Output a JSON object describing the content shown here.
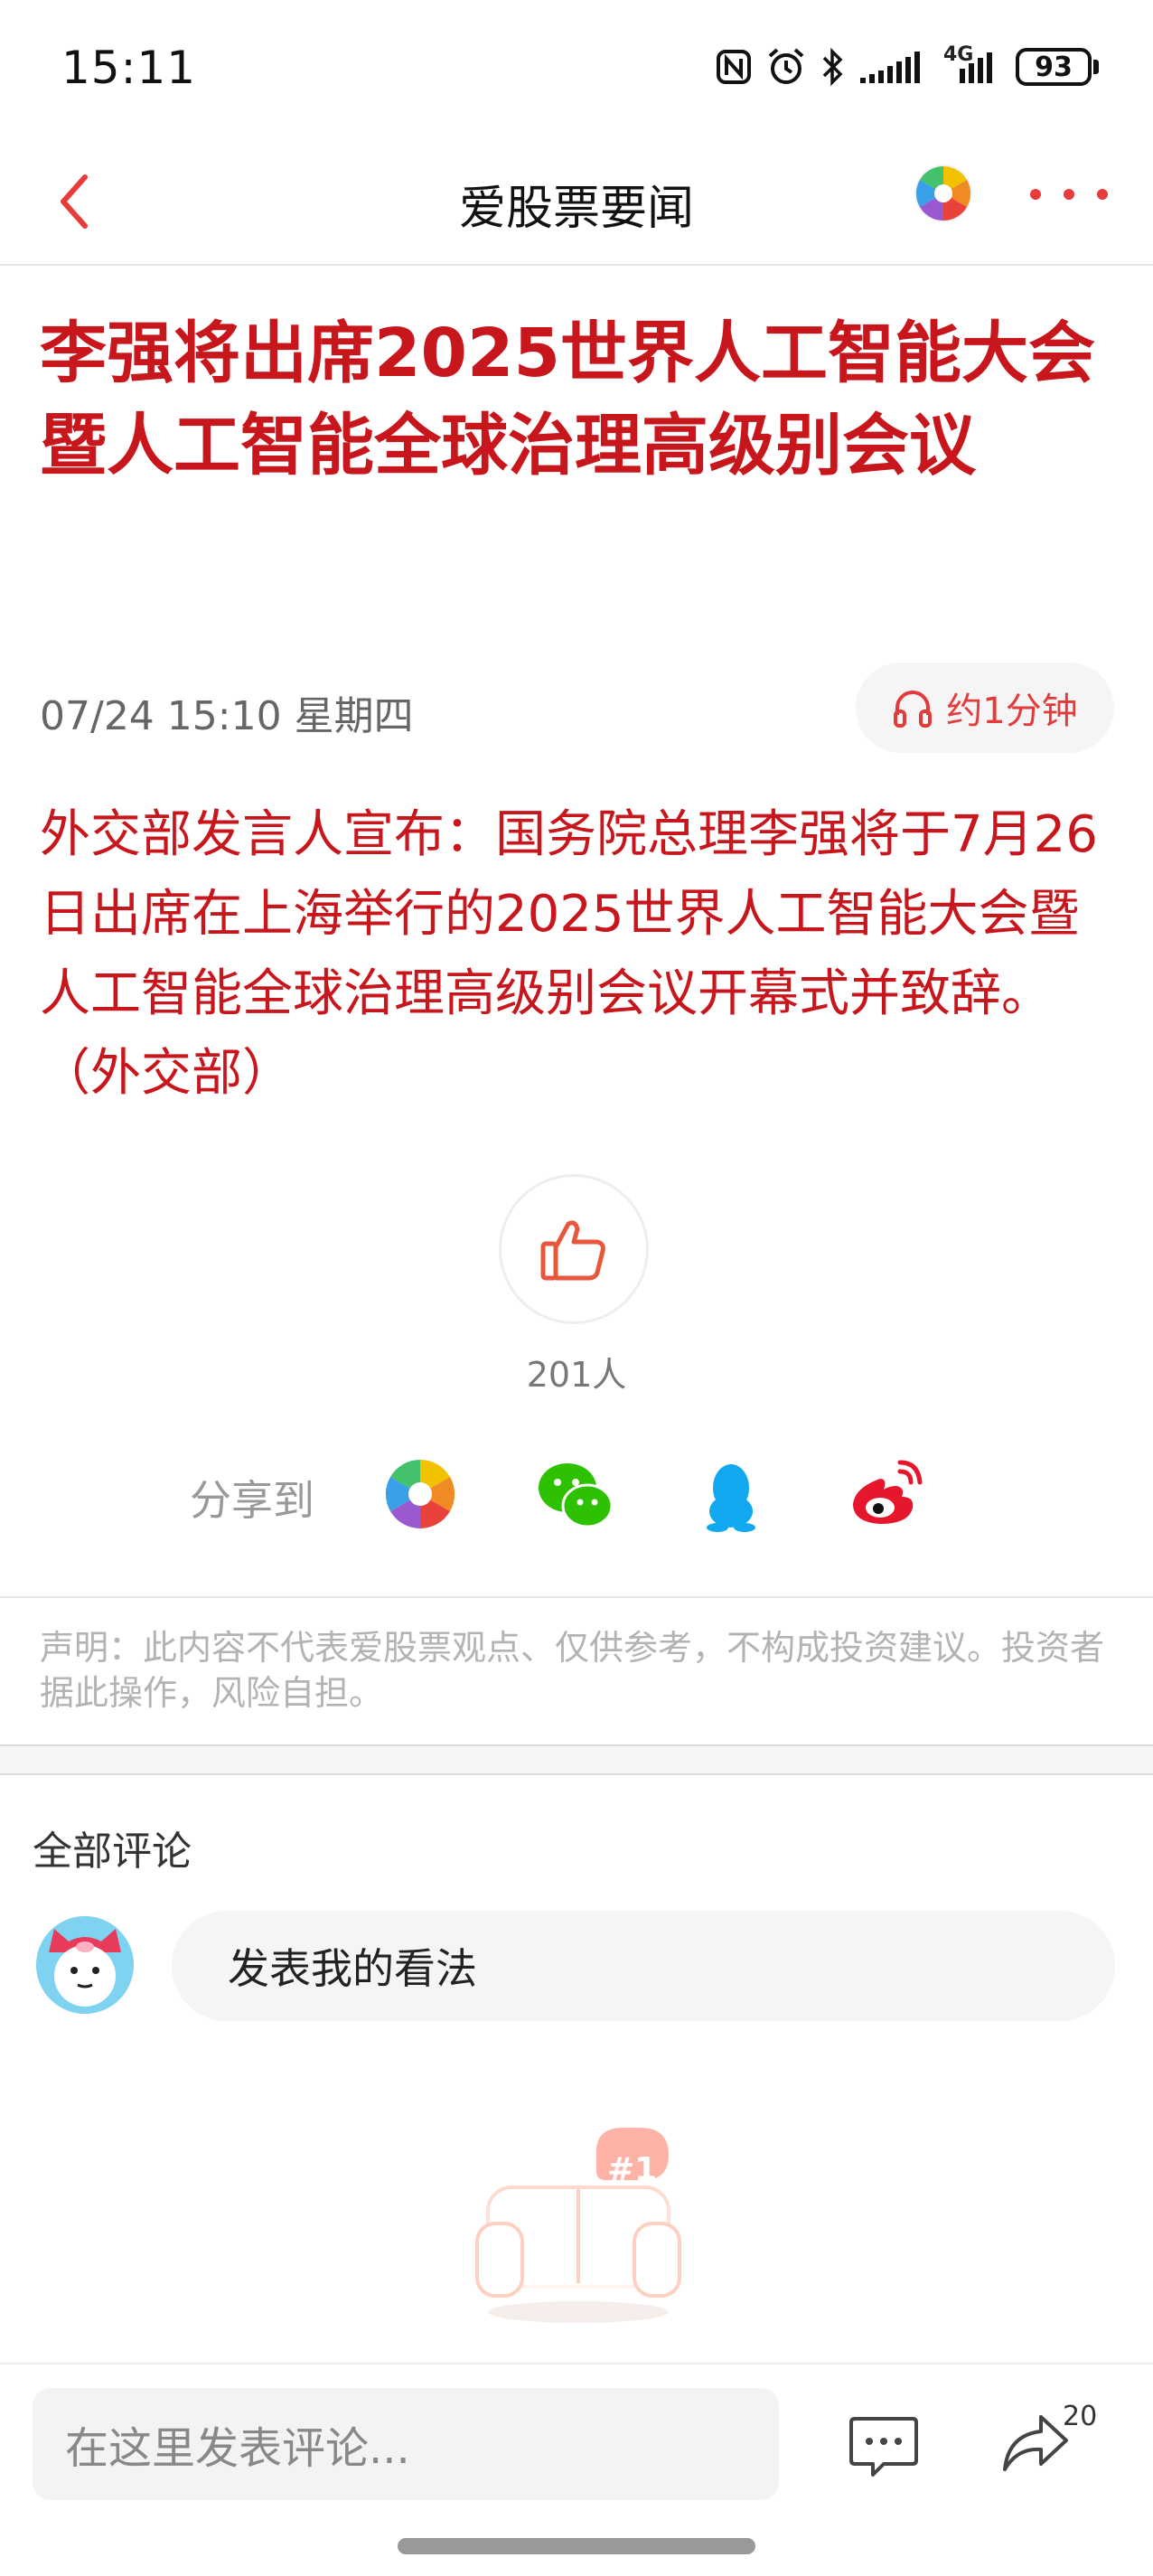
{
  "status_bar": {
    "time": "15:11",
    "network": "4G",
    "battery": "93"
  },
  "nav": {
    "title": "爱股票要闻",
    "accent_color": "#e83b3b"
  },
  "article": {
    "title": "李强将出席2025世界人工智能大会暨人工智能全球治理高级别会议",
    "date": "07/24 15:10 星期四",
    "audio_label": "约1分钟",
    "summary": "外交部发言人宣布：国务院总理李强将于7月26日出席在上海举行的2025世界人工智能大会暨人工智能全球治理高级别会议开幕式并致辞。（外交部）",
    "title_color": "#c8161d"
  },
  "like": {
    "count_label": "201人"
  },
  "share": {
    "label": "分享到",
    "targets": [
      "aigupiao-icon",
      "wechat-icon",
      "qq-icon",
      "weibo-icon"
    ]
  },
  "disclaimer": {
    "text": "声明：此内容不代表爱股票观点、仅供参考，不构成投资建议。投资者据此操作，风险自担。"
  },
  "comments": {
    "title": "全部评论",
    "prompt": "发表我的看法",
    "empty_badge": "#1"
  },
  "bottom_bar": {
    "input_placeholder": "在这里发表评论...",
    "share_count": "20"
  }
}
